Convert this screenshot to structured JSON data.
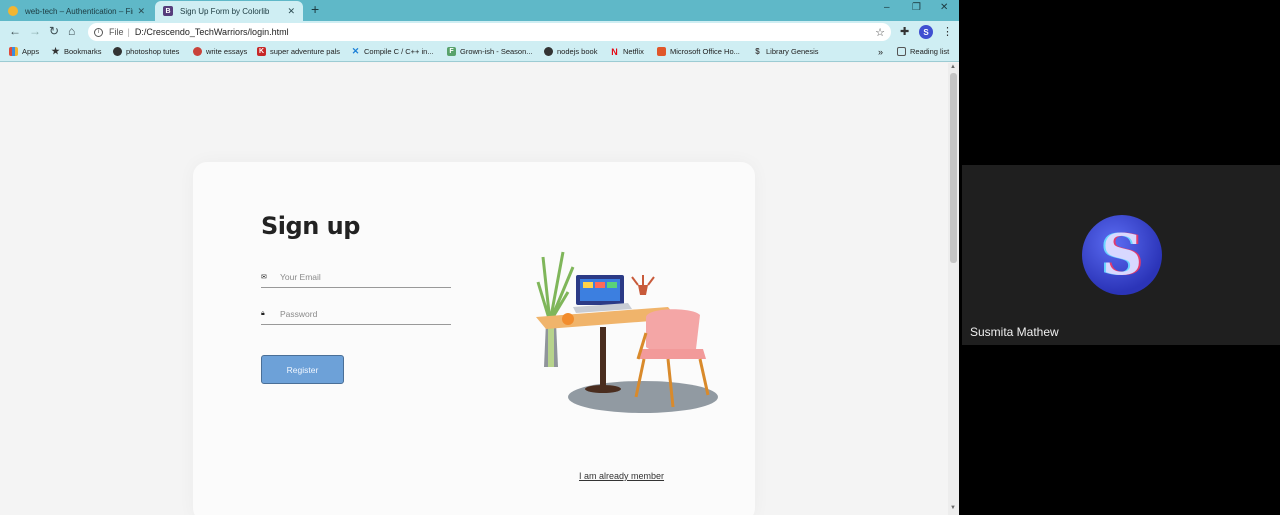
{
  "browser": {
    "tabs": [
      {
        "label": "web-tech – Authentication – Fire",
        "state": "inactive"
      },
      {
        "label": "Sign Up Form by Colorlib",
        "state": "active"
      }
    ],
    "omnibox": {
      "scheme": "File",
      "url": "D:/Crescendo_TechWarriors/login.html"
    },
    "profile_initial": "S",
    "bookmarks": [
      {
        "label": "Apps",
        "icon": "apps-icon"
      },
      {
        "label": "Bookmarks",
        "icon": "star-icon"
      },
      {
        "label": "photoshop tutes",
        "icon": "globe-icon"
      },
      {
        "label": "write essays",
        "icon": "essay-icon"
      },
      {
        "label": "super adventure pals",
        "icon": "k-icon"
      },
      {
        "label": "Compile C / C++ in...",
        "icon": "vscode-icon"
      },
      {
        "label": "Grown-ish - Season...",
        "icon": "gf-icon"
      },
      {
        "label": "nodejs book",
        "icon": "globe-icon"
      },
      {
        "label": "Netflix",
        "icon": "netflix-icon"
      },
      {
        "label": "Microsoft Office Ho...",
        "icon": "office-icon"
      },
      {
        "label": "Library Genesis",
        "icon": "lg-icon"
      }
    ],
    "reading_list": "Reading list"
  },
  "page": {
    "title": "Sign up",
    "email_placeholder": "Your Email",
    "password_placeholder": "Password",
    "register_label": "Register",
    "already_member": "I am already member"
  },
  "meeting": {
    "participant_name": "Susmita Mathew",
    "avatar_letter": "S"
  },
  "colors": {
    "tabstrip": "#5fb8c8",
    "toolbar": "#cfeef3",
    "register_button": "#6da1d8",
    "avatar": "#3f4fd1"
  }
}
